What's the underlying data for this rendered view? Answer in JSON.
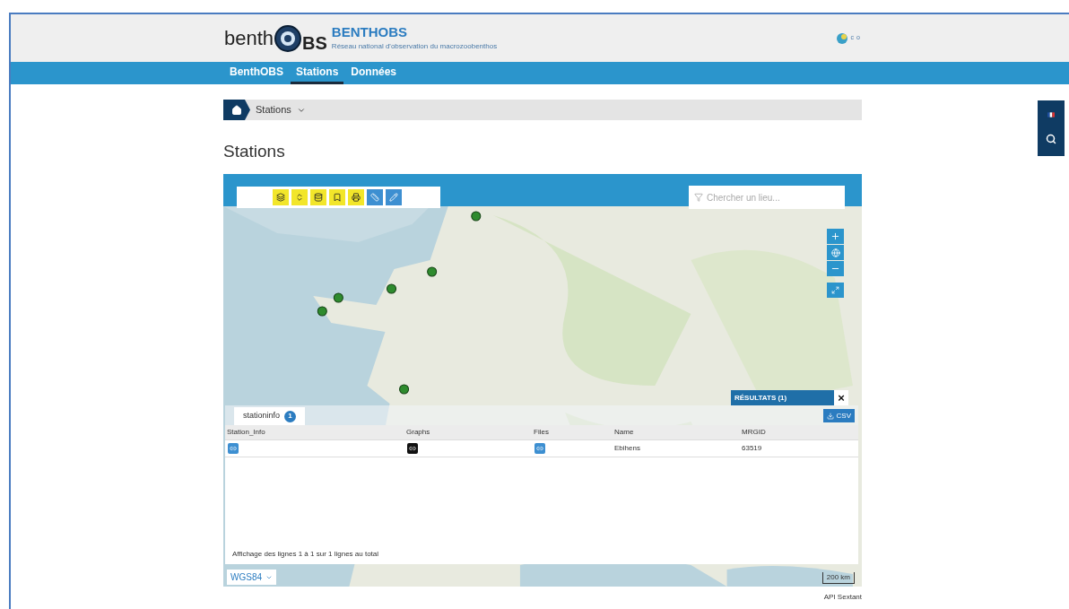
{
  "header": {
    "logo_left": "benth",
    "logo_right": "BS",
    "title": "BENTHOBS",
    "subtitle": "Réseau national d'observation du macrozoobenthos",
    "partner_logo": "co"
  },
  "nav": [
    {
      "label": "BenthOBS",
      "selected": false
    },
    {
      "label": "Stations",
      "selected": true
    },
    {
      "label": "Données",
      "selected": false
    }
  ],
  "breadcrumb": {
    "label": "Stations"
  },
  "page_title": "Stations",
  "map": {
    "toolbar": [
      {
        "kind": "layers"
      },
      {
        "kind": "sort"
      },
      {
        "kind": "add-layer"
      },
      {
        "kind": "bookmark"
      },
      {
        "kind": "print"
      },
      {
        "kind": "measure"
      },
      {
        "kind": "draw"
      }
    ],
    "search": {
      "placeholder": "Chercher un lieu..."
    },
    "results": {
      "title": "RÉSULTATS (1)",
      "close": "×",
      "tab": {
        "label": "stationinfo",
        "count": "1"
      },
      "export": "CSV",
      "columns": [
        "Station_Info",
        "Graphs",
        "Files",
        "Name",
        "MRGID"
      ],
      "rows": [
        {
          "cells": [
            {
              "kind": "link"
            },
            {
              "kind": "link-dark"
            },
            {
              "kind": "link"
            },
            {
              "kind": "text",
              "text": "Ebihens"
            },
            {
              "kind": "text",
              "text": "63519"
            }
          ]
        }
      ],
      "footer": "Affichage des lignes 1 à 1 sur 1 lignes au total"
    },
    "projection": "WGS84",
    "scale": "200 km"
  },
  "attribution": "API Sextant"
}
